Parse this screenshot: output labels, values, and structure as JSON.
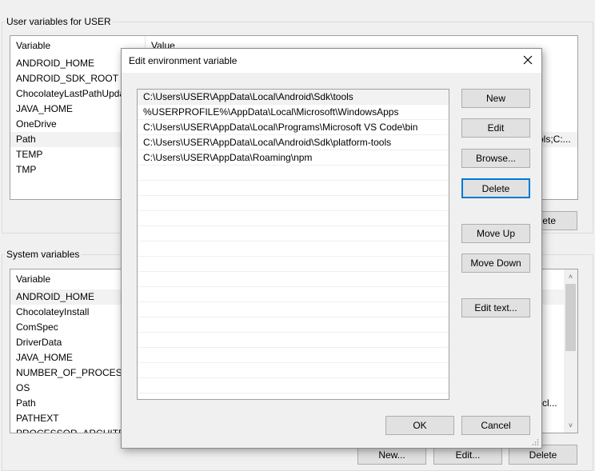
{
  "user_vars": {
    "group_label": "User variables for USER",
    "col_variable": "Variable",
    "col_value": "Value",
    "rows": [
      {
        "name": "ANDROID_HOME",
        "value": ""
      },
      {
        "name": "ANDROID_SDK_ROOT",
        "value": ""
      },
      {
        "name": "ChocolateyLastPathUpda",
        "value": ""
      },
      {
        "name": "JAVA_HOME",
        "value": ""
      },
      {
        "name": "OneDrive",
        "value": ""
      },
      {
        "name": "Path",
        "value": "ols;C:..."
      },
      {
        "name": "TEMP",
        "value": ""
      },
      {
        "name": "TMP",
        "value": ""
      }
    ],
    "delete_partial": "lete"
  },
  "system_vars": {
    "group_label": "System variables",
    "col_variable": "Variable",
    "rows": [
      {
        "name": "ANDROID_HOME",
        "value": ""
      },
      {
        "name": "ChocolateyInstall",
        "value": ""
      },
      {
        "name": "ComSpec",
        "value": ""
      },
      {
        "name": "DriverData",
        "value": ""
      },
      {
        "name": "JAVA_HOME",
        "value": ""
      },
      {
        "name": "NUMBER_OF_PROCESSO",
        "value": ""
      },
      {
        "name": "OS",
        "value": ""
      },
      {
        "name": "Path",
        "value": "cl..."
      },
      {
        "name": "PATHEXT",
        "value": ""
      },
      {
        "name": "PROCESSOR_ARCHITECT",
        "value": ""
      }
    ],
    "new_label": "New...",
    "edit_label": "Edit...",
    "delete_label": "Delete"
  },
  "dialog": {
    "title": "Edit environment variable",
    "paths": [
      "C:\\Users\\USER\\AppData\\Local\\Android\\Sdk\\tools",
      "%USERPROFILE%\\AppData\\Local\\Microsoft\\WindowsApps",
      "C:\\Users\\USER\\AppData\\Local\\Programs\\Microsoft VS Code\\bin",
      "C:\\Users\\USER\\AppData\\Local\\Android\\Sdk\\platform-tools",
      "C:\\Users\\USER\\AppData\\Roaming\\npm"
    ],
    "buttons": {
      "new": "New",
      "edit": "Edit",
      "browse": "Browse...",
      "delete": "Delete",
      "move_up": "Move Up",
      "move_down": "Move Down",
      "edit_text": "Edit text...",
      "ok": "OK",
      "cancel": "Cancel"
    }
  },
  "colors": {
    "accent": "#0078d7",
    "selection": "#f2f2f2",
    "window_bg": "#f0f0f0"
  }
}
